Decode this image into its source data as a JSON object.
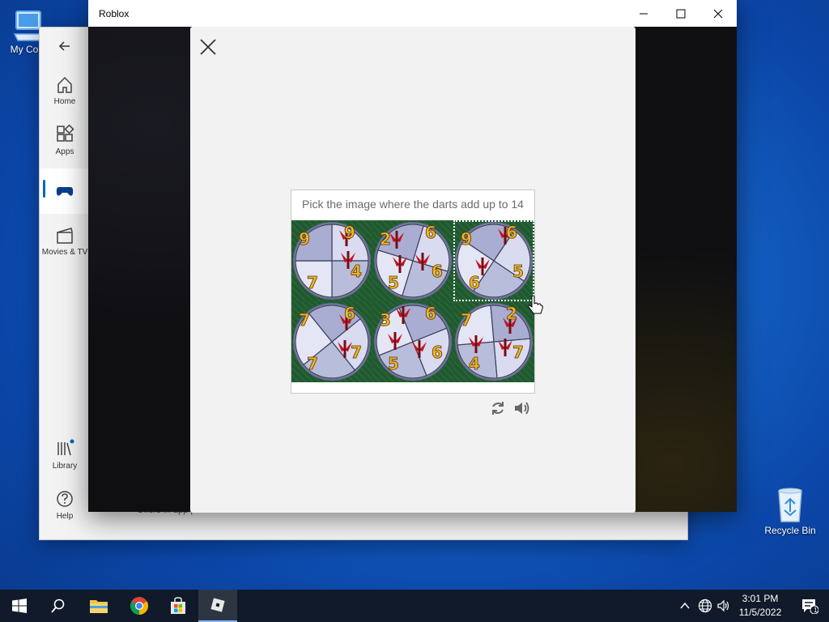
{
  "desktop": {
    "my_computer_label": "My Com",
    "recycle_bin_label": "Recycle Bin"
  },
  "store": {
    "nav": {
      "home": "Home",
      "apps": "Apps",
      "movies": "Movies & TV",
      "library": "Library",
      "help": "Help"
    },
    "footer_text": "Offers in-app purchases"
  },
  "roblox_window": {
    "title": "Roblox"
  },
  "captcha": {
    "prompt": "Pick the image where the darts add up to 14",
    "tiles": [
      {
        "numbers": [
          "9",
          "9",
          "4",
          "7"
        ]
      },
      {
        "numbers": [
          "2",
          "6",
          "6",
          "5"
        ]
      },
      {
        "numbers": [
          "9",
          "6",
          "5",
          "6"
        ]
      },
      {
        "numbers": [
          "7",
          "6",
          "7",
          "7"
        ]
      },
      {
        "numbers": [
          "3",
          "6",
          "6",
          "5"
        ]
      },
      {
        "numbers": [
          "7",
          "2",
          "7",
          "4"
        ]
      }
    ],
    "focused_tile": 2
  },
  "taskbar": {
    "time": "3:01 PM",
    "date": "11/5/2022",
    "notification_count": "1"
  },
  "colors": {
    "accent": "#0067c0",
    "tile_green": "#1f5a2e",
    "number_gold": "#f0b429",
    "dart_red": "#c1121f"
  }
}
